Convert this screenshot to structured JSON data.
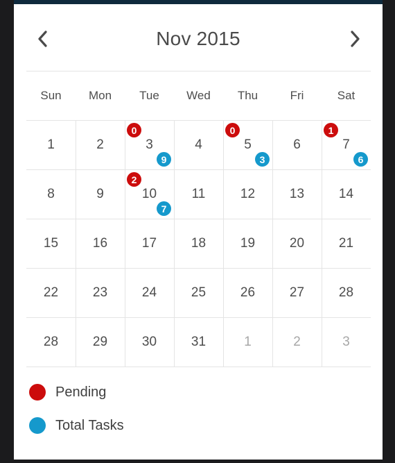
{
  "calendar": {
    "title": "Nov 2015",
    "weekdays": [
      "Sun",
      "Mon",
      "Tue",
      "Wed",
      "Thu",
      "Fri",
      "Sat"
    ],
    "weeks": [
      [
        {
          "d": "1"
        },
        {
          "d": "2"
        },
        {
          "d": "3",
          "pending": "0",
          "total": "9"
        },
        {
          "d": "4"
        },
        {
          "d": "5",
          "pending": "0",
          "total": "3"
        },
        {
          "d": "6"
        },
        {
          "d": "7",
          "pending": "1",
          "total": "6"
        }
      ],
      [
        {
          "d": "8"
        },
        {
          "d": "9"
        },
        {
          "d": "10",
          "pending": "2",
          "total": "7"
        },
        {
          "d": "11"
        },
        {
          "d": "12"
        },
        {
          "d": "13"
        },
        {
          "d": "14"
        }
      ],
      [
        {
          "d": "15"
        },
        {
          "d": "16"
        },
        {
          "d": "17"
        },
        {
          "d": "18"
        },
        {
          "d": "19"
        },
        {
          "d": "20"
        },
        {
          "d": "21"
        }
      ],
      [
        {
          "d": "22"
        },
        {
          "d": "23"
        },
        {
          "d": "24"
        },
        {
          "d": "25"
        },
        {
          "d": "26"
        },
        {
          "d": "27"
        },
        {
          "d": "28"
        }
      ],
      [
        {
          "d": "28"
        },
        {
          "d": "29"
        },
        {
          "d": "30"
        },
        {
          "d": "31"
        },
        {
          "d": "1",
          "muted": true
        },
        {
          "d": "2",
          "muted": true
        },
        {
          "d": "3",
          "muted": true
        }
      ]
    ]
  },
  "legend": [
    {
      "label": "Pending",
      "color": "#cc0c0c"
    },
    {
      "label": "Total Tasks",
      "color": "#1599cc"
    }
  ],
  "icons": {
    "prev": "chevron-left-icon",
    "next": "chevron-right-icon"
  }
}
